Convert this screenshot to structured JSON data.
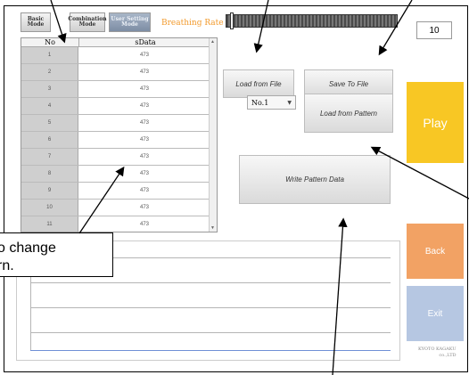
{
  "modes": {
    "basic": "Basic Mode",
    "combination": "Combination Mode",
    "user_setting": "User Setting Mode"
  },
  "breathing_rate_label": "Breathing Rate",
  "breathing_rate_value": "10",
  "table": {
    "headers": [
      "No",
      "sData"
    ],
    "rows": [
      {
        "no": "1",
        "sdata": "473"
      },
      {
        "no": "2",
        "sdata": "473"
      },
      {
        "no": "3",
        "sdata": "473"
      },
      {
        "no": "4",
        "sdata": "473"
      },
      {
        "no": "5",
        "sdata": "473"
      },
      {
        "no": "6",
        "sdata": "473"
      },
      {
        "no": "7",
        "sdata": "473"
      },
      {
        "no": "8",
        "sdata": "473"
      },
      {
        "no": "9",
        "sdata": "473"
      },
      {
        "no": "10",
        "sdata": "473"
      },
      {
        "no": "11",
        "sdata": "473"
      }
    ]
  },
  "buttons": {
    "load_from_file": "Load from File",
    "save_to_file": "Save To File",
    "load_from_pattern": "Load from Pattern",
    "write_pattern_data": "Write Pattern Data",
    "play": "Play",
    "back": "Back",
    "exit": "Exit"
  },
  "pattern_select": {
    "selected": "No.1"
  },
  "brand": {
    "line1": "KYOTO KAGAKU",
    "line2": "co.,LTD"
  },
  "callout": {
    "line1": "o change",
    "line2": "rn."
  },
  "colors": {
    "play": "#f8c724",
    "back": "#f2a264",
    "exit": "#b6c7e2",
    "rate_label": "#f29a2c"
  }
}
